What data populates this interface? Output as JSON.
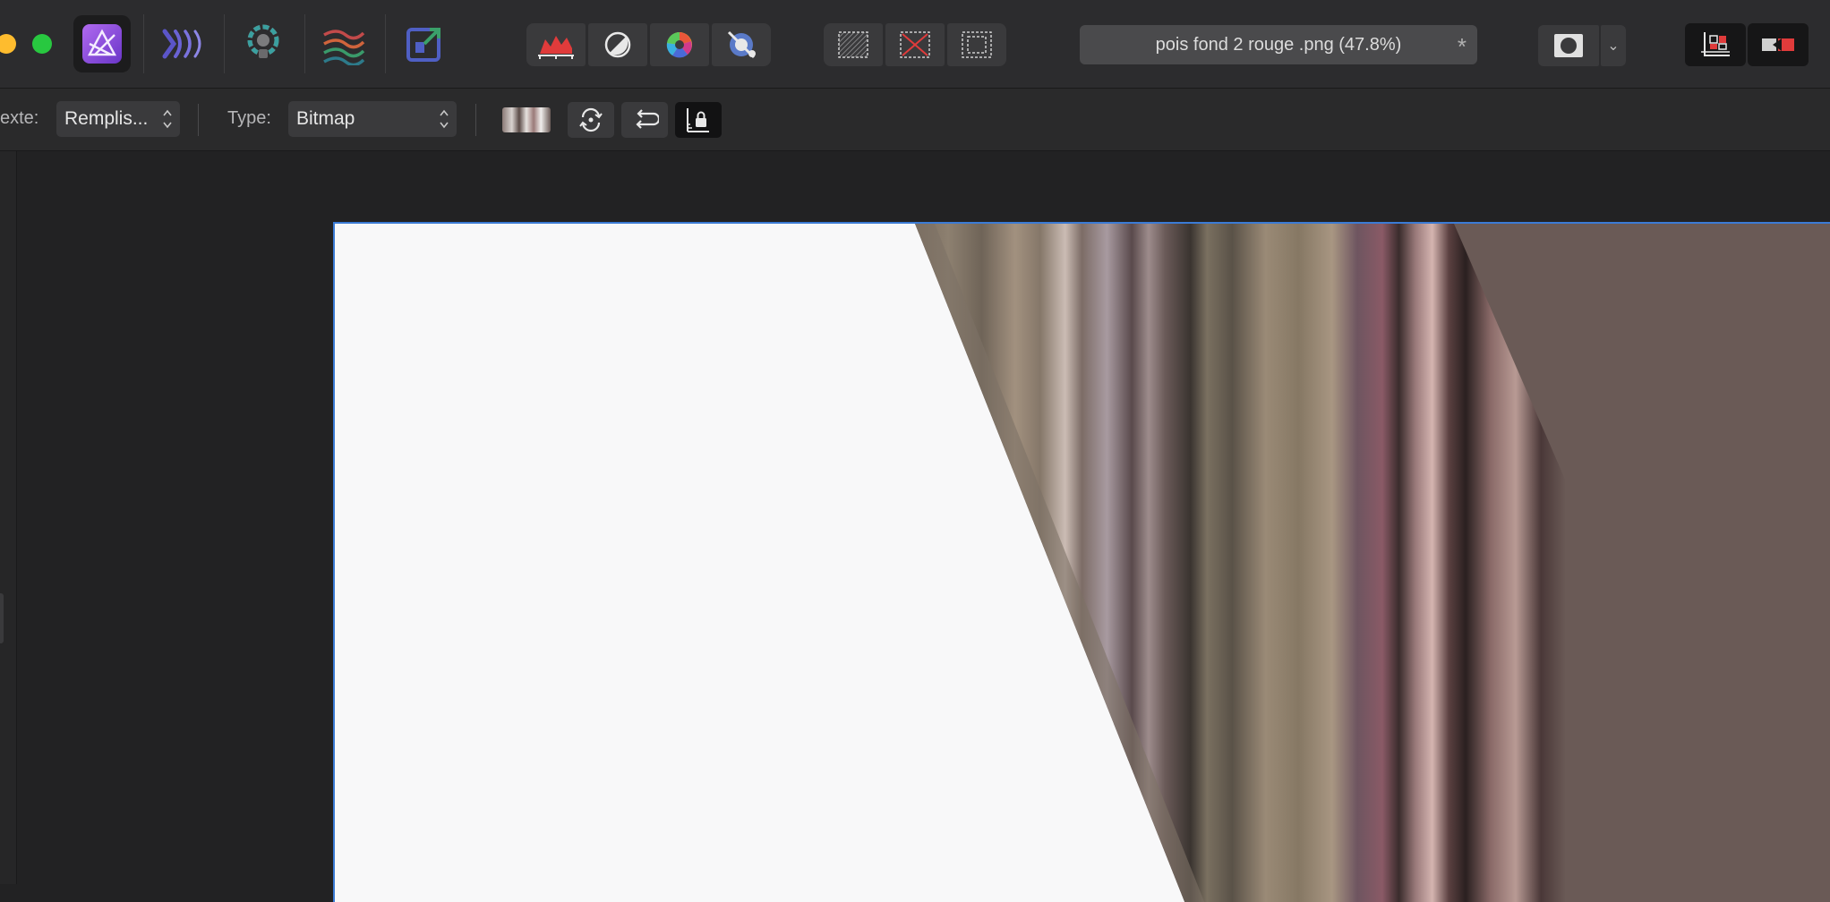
{
  "window": {
    "traffic_lights": [
      "minimize",
      "zoom"
    ]
  },
  "personas": [
    {
      "name": "photo-persona",
      "active": true
    },
    {
      "name": "liquify-persona",
      "active": false
    },
    {
      "name": "develop-persona",
      "active": false
    },
    {
      "name": "tone-mapping-persona",
      "active": false
    },
    {
      "name": "export-persona",
      "active": false
    }
  ],
  "toolbar": {
    "adjustment_icons": [
      "levels-icon",
      "auto-contrast-icon",
      "color-wheel-icon",
      "white-balance-icon"
    ],
    "selection_icons": [
      "select-all-icon",
      "deselect-icon",
      "invert-selection-icon"
    ],
    "document_tab": {
      "title": "pois fond 2 rouge .png (47.8%)",
      "modified_mark": "*"
    },
    "mask_caret": "⌄",
    "right_icons": [
      "snapping-icon",
      "assistant-icon"
    ]
  },
  "context": {
    "context_label": "exte:",
    "context_value": "Remplis...",
    "type_label": "Type:",
    "type_value": "Bitmap"
  },
  "colors": {
    "accent": "#3b7bd5",
    "persona_purple": "#8a4fd8",
    "canvas_bg": "#f8f8f9",
    "texture_base": "#6b5a55"
  }
}
